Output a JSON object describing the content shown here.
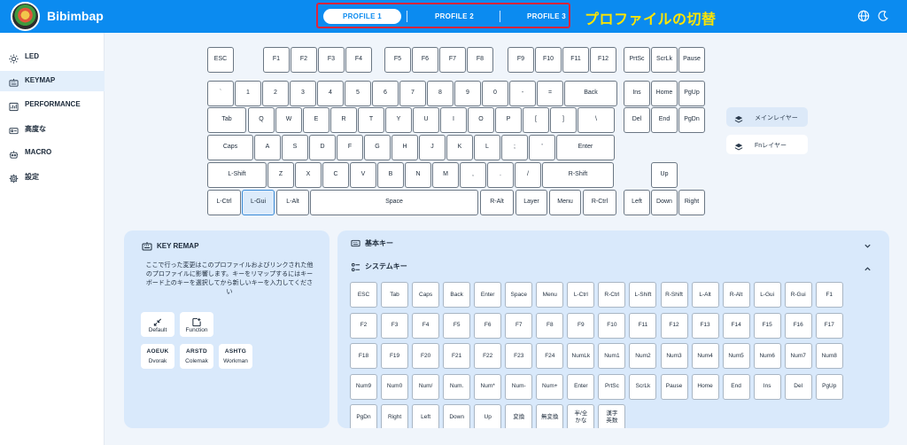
{
  "app": {
    "title": "Bibimbap"
  },
  "profiles": {
    "tabs": [
      "PROFILE 1",
      "PROFILE 2",
      "PROFILE 3"
    ],
    "active": "PROFILE 1",
    "annotation": "プロファイルの切替"
  },
  "toolbar": {
    "icons": [
      "globe-icon",
      "moon-icon"
    ]
  },
  "sidebar": {
    "items": [
      {
        "label": "LED",
        "icon": "sun-icon"
      },
      {
        "label": "KEYMAP",
        "icon": "keyboard-icon"
      },
      {
        "label": "PERFORMANCE",
        "icon": "performance-icon"
      },
      {
        "label": "高度な",
        "icon": "advanced-icon"
      },
      {
        "label": "MACRO",
        "icon": "macro-icon"
      },
      {
        "label": "設定",
        "icon": "gear-icon"
      }
    ],
    "active": "KEYMAP"
  },
  "keyboard": {
    "selected": "L-Gui",
    "rows": [
      [
        "ESC",
        "F1",
        "F2",
        "F3",
        "F4",
        "F5",
        "F6",
        "F7",
        "F8",
        "F9",
        "F10",
        "F11",
        "F12",
        "PrtSc",
        "ScrLk",
        "Pause"
      ],
      [
        "`",
        "1",
        "2",
        "3",
        "4",
        "5",
        "6",
        "7",
        "8",
        "9",
        "0",
        "-",
        "=",
        "Back",
        "Ins",
        "Home",
        "PgUp"
      ],
      [
        "Tab",
        "Q",
        "W",
        "E",
        "R",
        "T",
        "Y",
        "U",
        "I",
        "O",
        "P",
        "[",
        "]",
        "\\",
        "Del",
        "End",
        "PgDn"
      ],
      [
        "Caps",
        "A",
        "S",
        "D",
        "F",
        "G",
        "H",
        "J",
        "K",
        "L",
        ";",
        "'",
        "Enter"
      ],
      [
        "L-Shift",
        "Z",
        "X",
        "C",
        "V",
        "B",
        "N",
        "M",
        ",",
        ".",
        "/",
        "R-Shift",
        "Up"
      ],
      [
        "L-Ctrl",
        "L-Gui",
        "L-Alt",
        "Space",
        "R-Alt",
        "Layer",
        "Menu",
        "R-Ctrl",
        "Left",
        "Down",
        "Right"
      ]
    ]
  },
  "layers": {
    "items": [
      {
        "label": "メインレイヤー",
        "icon": "layers-icon"
      },
      {
        "label": "Fnレイヤー",
        "icon": "layers-icon"
      }
    ],
    "active": "メインレイヤー"
  },
  "remap": {
    "title": "KEY REMAP",
    "description": "ここで行った変更はこのプロファイルおよびリンクされた他のプロファイルに影響します。キーをリマップするにはキーボード上のキーを選択してから新しいキーを入力してください",
    "presets": [
      {
        "label": "Default",
        "icon": "reset-icon"
      },
      {
        "label": "Function",
        "icon": "function-icon"
      }
    ],
    "layouts": [
      {
        "code": "AOEUK",
        "label": "Dvorak"
      },
      {
        "code": "ARSTD",
        "label": "Colemak"
      },
      {
        "code": "ASHTG",
        "label": "Workman"
      }
    ]
  },
  "keylist": {
    "sections": [
      {
        "title": "基本キー",
        "icon": "keyboard-icon",
        "expanded": false
      },
      {
        "title": "システムキー",
        "icon": "system-icon",
        "expanded": true
      }
    ],
    "system_keys": [
      [
        "ESC",
        "Tab",
        "Caps",
        "Back",
        "Enter",
        "Space",
        "Menu",
        "L-Ctrl",
        "R-Ctrl",
        "L-Shift",
        "R-Shift",
        "L-Alt",
        "R-Alt",
        "L-Gui",
        "R-Gui",
        "F1"
      ],
      [
        "F2",
        "F3",
        "F4",
        "F5",
        "F6",
        "F7",
        "F8",
        "F9",
        "F10",
        "F11",
        "F12",
        "F13",
        "F14",
        "F15",
        "F16",
        "F17"
      ],
      [
        "F18",
        "F19",
        "F20",
        "F21",
        "F22",
        "F23",
        "F24",
        "NumLk",
        "Num1",
        "Num2",
        "Num3",
        "Num4",
        "Num5",
        "Num6",
        "Num7",
        "Num8"
      ],
      [
        "Num9",
        "Num0",
        "Num/",
        "Num.",
        "Num*",
        "Num-",
        "Num+",
        "Enter",
        "PrtSc",
        "ScrLk",
        "Pause",
        "Home",
        "End",
        "Ins",
        "Del",
        "PgUp"
      ],
      [
        "PgDn",
        "Right",
        "Left",
        "Down",
        "Up",
        "変換",
        "無変換",
        "半/全\nかな",
        "漢字\n英数"
      ]
    ]
  },
  "colors": {
    "accent": "#0b8bf0",
    "panel": "#d9e9fb",
    "highlight": "#e0243b",
    "annotation": "#ffe500"
  }
}
